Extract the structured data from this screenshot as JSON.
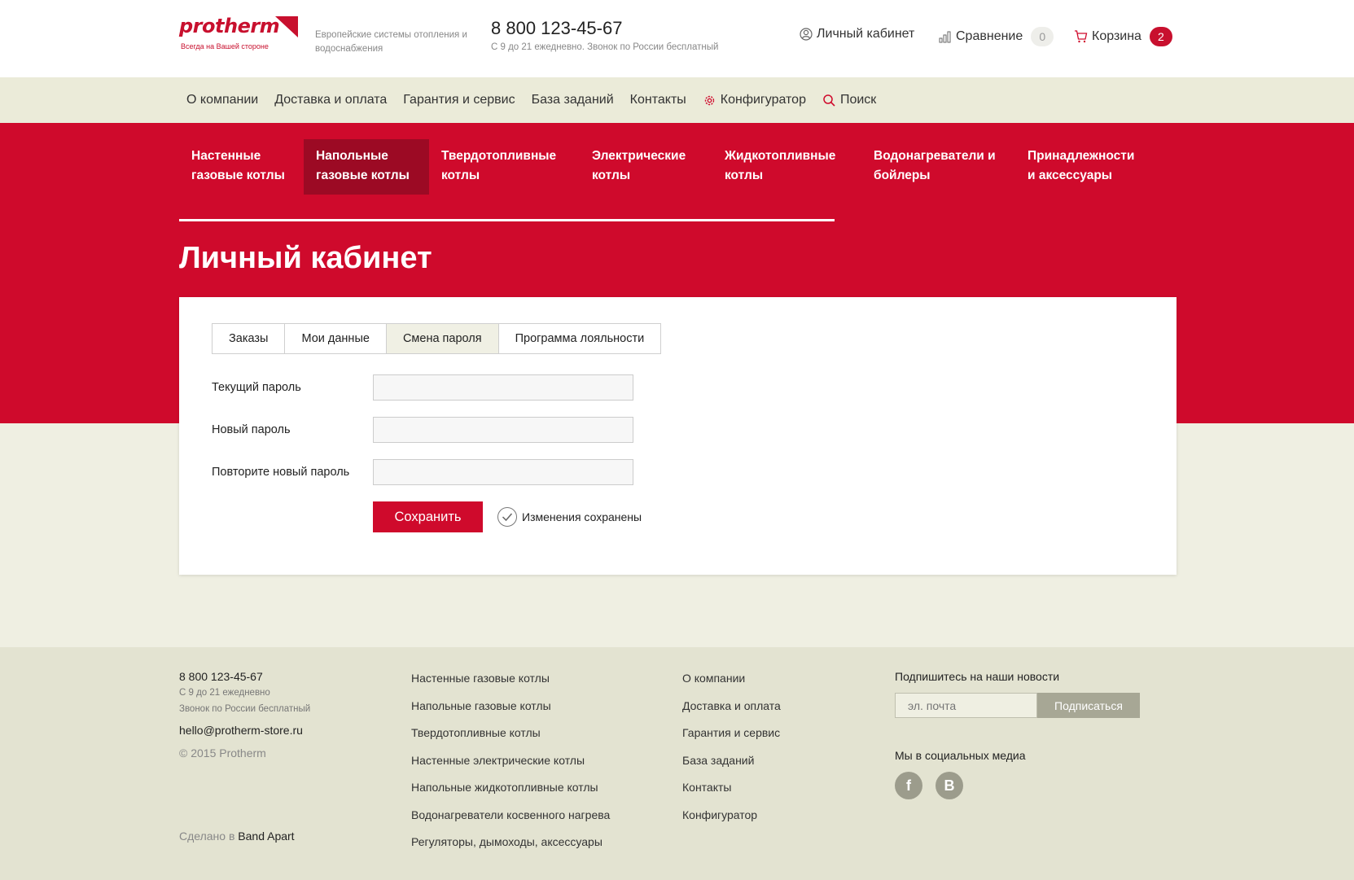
{
  "header": {
    "logo_text": "protherm",
    "logo_tagline": "Всегда на Вашей стороне",
    "tagline": "Европейские системы отопления и водоснабжения",
    "phone": "8 800 123-45-67",
    "hours": "С 9 до 21 ежедневно. Звонок по России бесплатный",
    "cabinet_label": "Личный кабинет",
    "compare_label": "Сравнение",
    "compare_count": "0",
    "cart_label": "Корзина",
    "cart_count": "2"
  },
  "subnav": {
    "items": [
      "О компании",
      "Доставка и оплата",
      "Гарантия и сервис",
      "База заданий",
      "Контакты",
      "Конфигуратор",
      "Поиск"
    ]
  },
  "categories": [
    "Настенные газовые котлы",
    "Напольные газовые котлы",
    "Твердотопливные котлы",
    "Электрические котлы",
    "Жидкотопливные котлы",
    "Водонагреватели и бойлеры",
    "Принадлежности и аксессуары"
  ],
  "page_title": "Личный кабинет",
  "tabs": [
    "Заказы",
    "Мои данные",
    "Смена пароля",
    "Программа лояльности"
  ],
  "form": {
    "current_label": "Текущий пароль",
    "new_label": "Новый пароль",
    "repeat_label": "Повторите новый пароль",
    "save_label": "Сохранить",
    "saved_msg": "Изменения сохранены"
  },
  "footer": {
    "phone": "8 800 123-45-67",
    "hours1": "С 9 до 21 ежедневно",
    "hours2": "Звонок по России бесплатный",
    "email": "hello@protherm-store.ru",
    "copyright": "© 2015 Protherm",
    "made_prefix": "Сделано в",
    "made_by": "Band Apart",
    "products": [
      "Настенные газовые котлы",
      "Напольные газовые котлы",
      "Твердотопливные котлы",
      "Настенные электрические котлы",
      "Напольные жидкотопливные котлы",
      "Водонагреватели косвенного нагрева",
      "Регуляторы, дымоходы, аксессуары"
    ],
    "info": [
      "О компании",
      "Доставка и оплата",
      "Гарантия и сервис",
      "База заданий",
      "Контакты",
      "Конфигуратор"
    ],
    "subscribe_title": "Подпишитесь на наши новости",
    "email_placeholder": "эл. почта",
    "subscribe_button": "Подписаться",
    "social_title": "Мы в социальных медиа",
    "social": [
      "f",
      "В"
    ]
  },
  "colors": {
    "brand_red": "#cf0a2c",
    "active_category": "#9c0a24",
    "cream": "#efefe2",
    "footer_bg": "#e3e3d1"
  }
}
